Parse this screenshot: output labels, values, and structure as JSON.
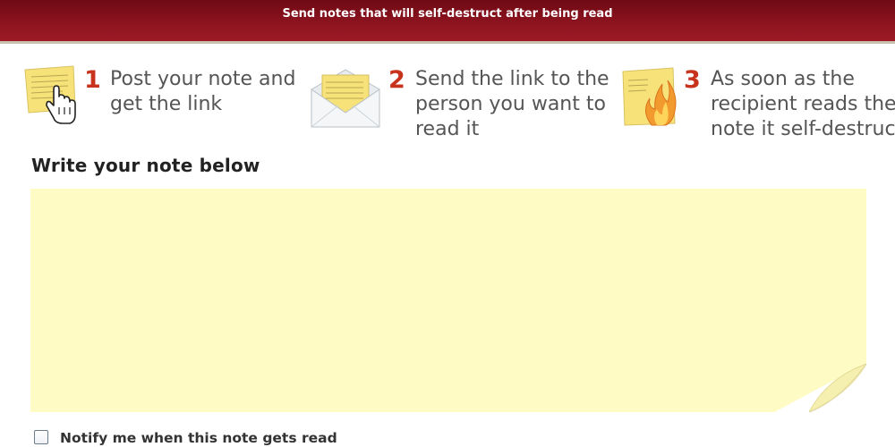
{
  "header": {
    "tagline": "Send notes that will self-destruct after being read"
  },
  "steps": [
    {
      "number": "1",
      "text": "Post your note and get the link",
      "icon": "sticky-note-with-hand-cursor-icon"
    },
    {
      "number": "2",
      "text": "Send the link to the person you want to read it",
      "icon": "envelope-with-note-icon"
    },
    {
      "number": "3",
      "text": "As soon as the recipient reads the note it self-destruct",
      "icon": "burning-note-icon"
    }
  ],
  "form": {
    "heading": "Write your note below",
    "note_value": "",
    "notify_label": "Notify me when this note gets read",
    "notify_checked": false
  },
  "colors": {
    "header_bg": "#8f1420",
    "step_number": "#c8331e",
    "note_bg": "#fefbc4",
    "step_text": "#555555"
  }
}
